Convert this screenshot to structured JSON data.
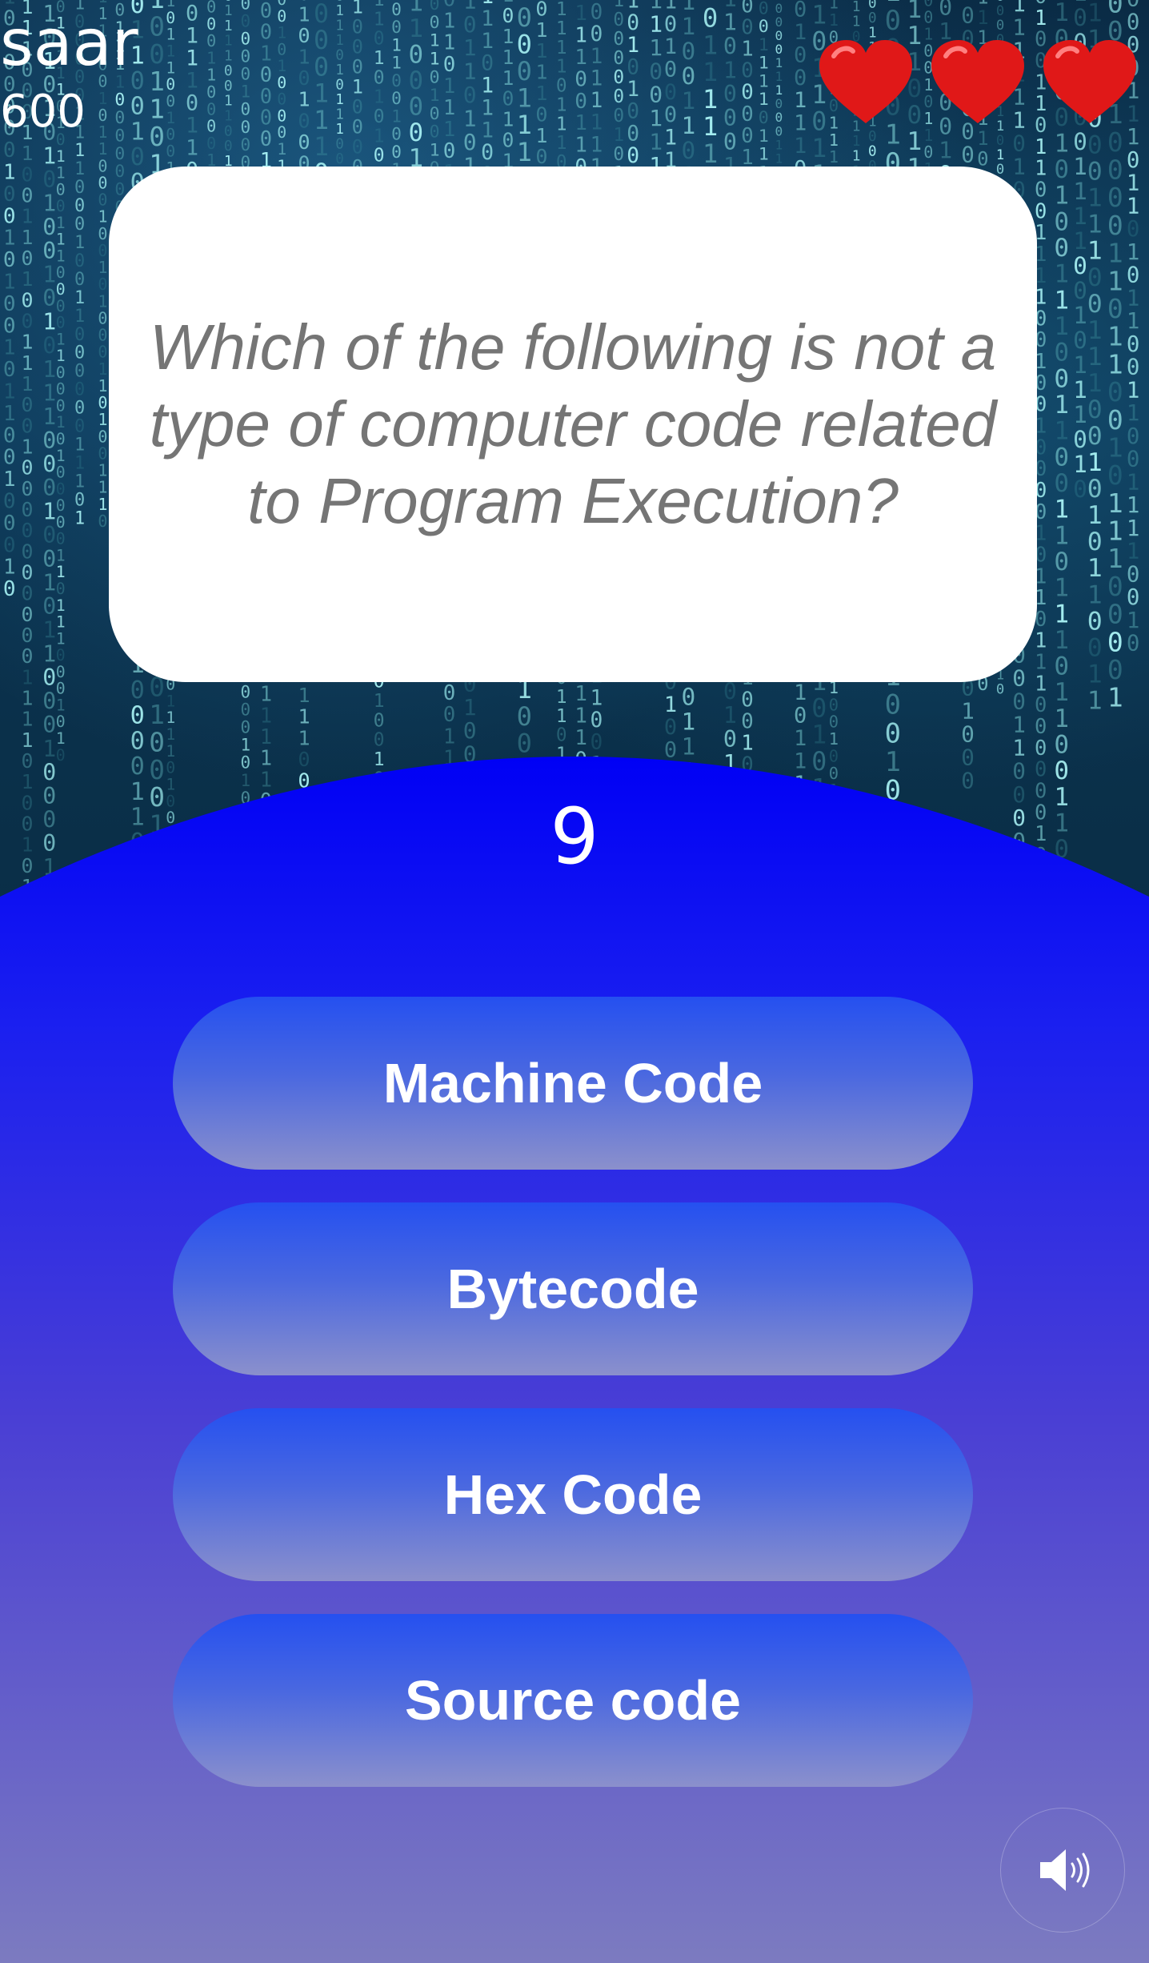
{
  "player": {
    "name": "saar",
    "score": "600"
  },
  "lives": {
    "count": 3,
    "icon": "heart-icon",
    "color": "#e01818"
  },
  "question": {
    "text": "Which of the following is not a type of computer code related to Program Execution?"
  },
  "timer": {
    "value": "9"
  },
  "answers": [
    {
      "label": "Machine Code"
    },
    {
      "label": "Bytecode"
    },
    {
      "label": "Hex Code"
    },
    {
      "label": "Source code"
    }
  ],
  "sound": {
    "icon": "speaker-icon"
  },
  "colors": {
    "arc_blue": "#0000f5",
    "bottom_gradient_end": "#7c7bc0",
    "button_top": "#2550f0",
    "button_bottom": "#8b90cc"
  }
}
